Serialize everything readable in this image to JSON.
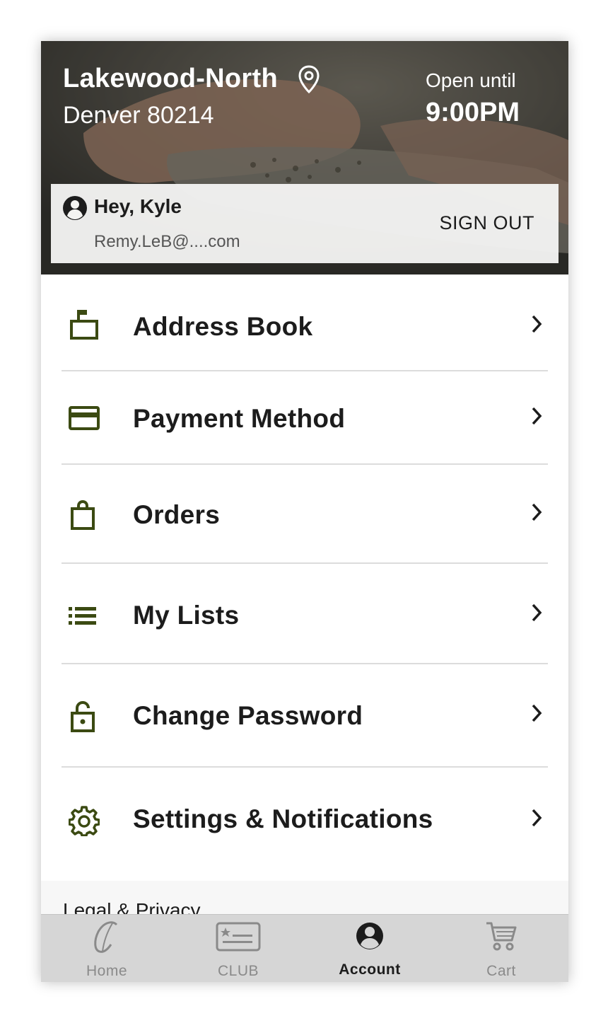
{
  "store": {
    "name": "Lakewood-North",
    "city_zip": "Denver 80214",
    "open_label": "Open until",
    "open_time": "9:00PM"
  },
  "user": {
    "greeting": "Hey, Kyle",
    "email": "Remy.LeB@....com",
    "sign_out_label": "SIGN OUT"
  },
  "menu": {
    "items": [
      {
        "label": "Address Book",
        "icon": "mailbox-icon"
      },
      {
        "label": "Payment Method",
        "icon": "credit-card-icon"
      },
      {
        "label": "Orders",
        "icon": "shopping-bag-icon"
      },
      {
        "label": "My Lists",
        "icon": "list-icon"
      },
      {
        "label": "Change Password",
        "icon": "lock-icon"
      },
      {
        "label": "Settings & Notifications",
        "icon": "gear-icon"
      }
    ]
  },
  "legal": {
    "label": "Legal & Privacy"
  },
  "tabbar": {
    "tabs": [
      {
        "label": "Home",
        "icon": "home-logo-icon",
        "active": false
      },
      {
        "label": "CLUB",
        "icon": "club-card-icon",
        "active": false
      },
      {
        "label": "Account",
        "icon": "account-icon",
        "active": true
      },
      {
        "label": "Cart",
        "icon": "cart-icon",
        "active": false
      }
    ]
  },
  "colors": {
    "icon_accent": "#3b4a12",
    "text_primary": "#1c1c1c",
    "tabbar_bg": "#d6d6d6",
    "tab_inactive": "#8a8a8a"
  }
}
